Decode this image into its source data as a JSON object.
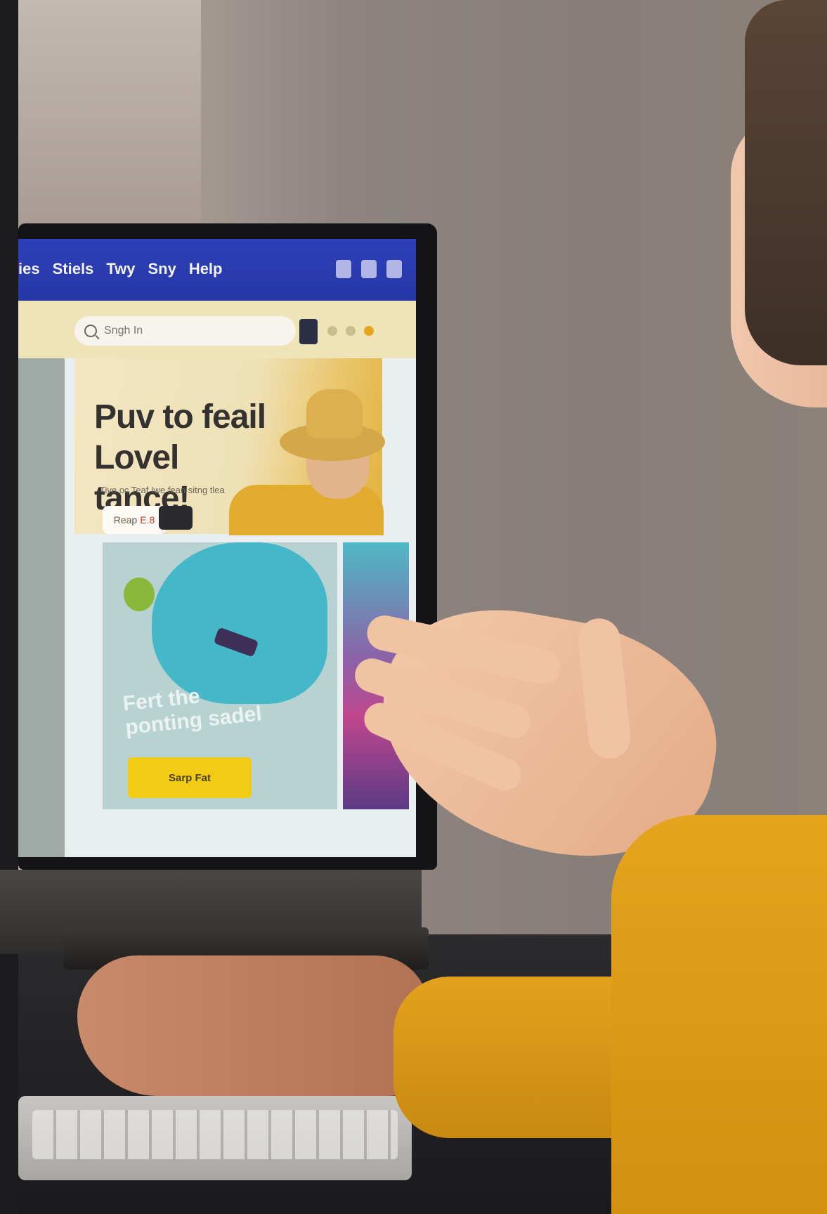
{
  "screen": {
    "menu": [
      "ies",
      "Stiels",
      "Twy",
      "Sny",
      "Help"
    ],
    "search": {
      "placeholder": "Sngh In"
    },
    "hero": {
      "title_line1": "Puv to feail",
      "title_line2": "Lovel tance!",
      "subtitle": "Tive oc Teaf Iwe fean sitng tlea",
      "button_label": "Reap",
      "button_badge": "E.8"
    },
    "card": {
      "title_line1": "Fert the",
      "title_line2": "ponting sadel",
      "button_label": "Sarp Fat"
    }
  },
  "colors": {
    "topbar": "#2637a6",
    "search_area": "#efe3b8",
    "cta_yellow": "#f2cc14",
    "sweater": "#d9981a"
  }
}
